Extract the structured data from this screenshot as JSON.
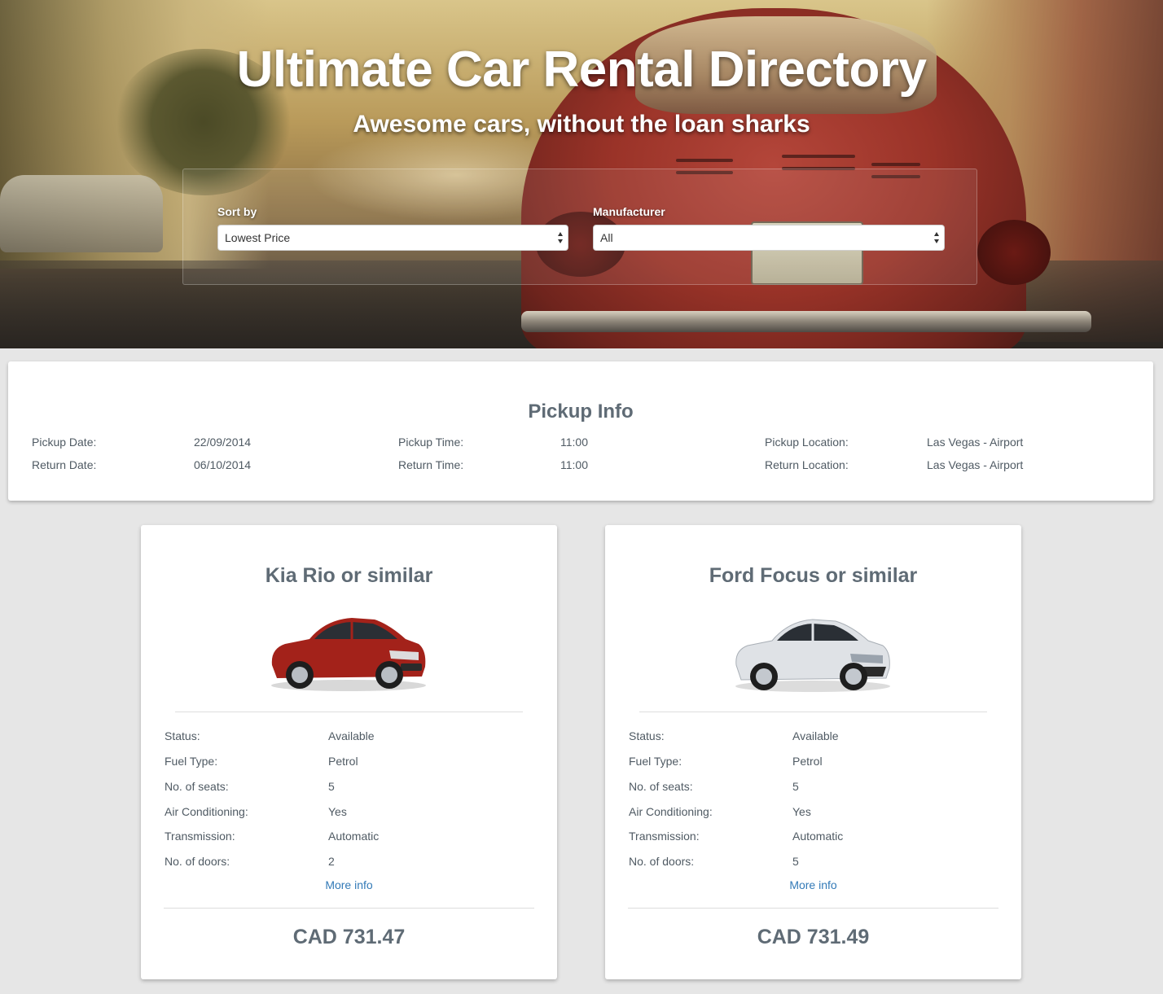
{
  "hero": {
    "title": "Ultimate Car Rental Directory",
    "subtitle": "Awesome cars, without the loan sharks"
  },
  "filters": {
    "sort_label": "Sort by",
    "sort_value": "Lowest Price",
    "manufacturer_label": "Manufacturer",
    "manufacturer_value": "All"
  },
  "pickup": {
    "title": "Pickup Info",
    "pickup_date_label": "Pickup Date:",
    "pickup_date": "22/09/2014",
    "return_date_label": "Return Date:",
    "return_date": "06/10/2014",
    "pickup_time_label": "Pickup Time:",
    "pickup_time": "11:00",
    "return_time_label": "Return Time:",
    "return_time": "11:00",
    "pickup_location_label": "Pickup Location:",
    "pickup_location": "Las Vegas - Airport",
    "return_location_label": "Return Location:",
    "return_location": "Las Vegas - Airport"
  },
  "spec_labels": {
    "status": "Status:",
    "fuel": "Fuel Type:",
    "seats": "No. of seats:",
    "ac": "Air Conditioning:",
    "transmission": "Transmission:",
    "doors": "No. of doors:"
  },
  "cars": [
    {
      "name": "Kia Rio or similar",
      "status": "Available",
      "fuel": "Petrol",
      "seats": "5",
      "ac": "Yes",
      "transmission": "Automatic",
      "doors": "2",
      "more_info": "More info",
      "price": "CAD 731.47",
      "color": "#a3221a"
    },
    {
      "name": "Ford Focus or similar",
      "status": "Available",
      "fuel": "Petrol",
      "seats": "5",
      "ac": "Yes",
      "transmission": "Automatic",
      "doors": "5",
      "more_info": "More info",
      "price": "CAD 731.49",
      "color": "#d9dce0"
    }
  ]
}
